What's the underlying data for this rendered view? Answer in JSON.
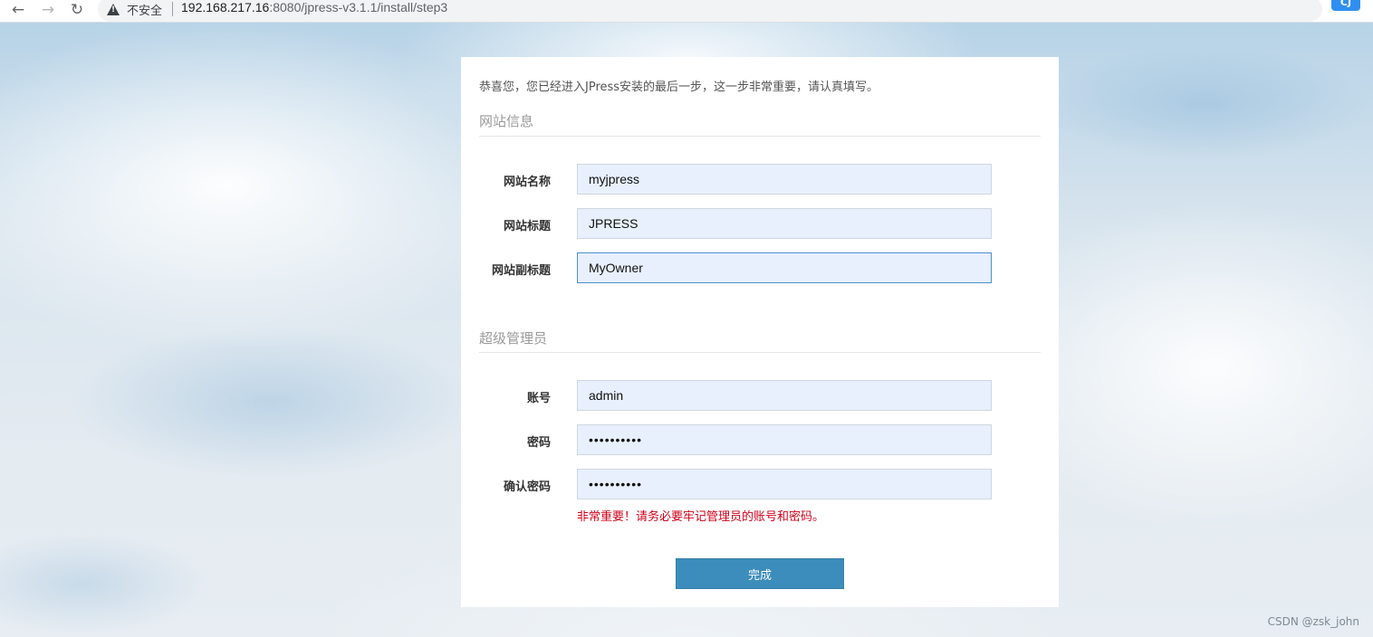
{
  "browser": {
    "insecure_label": "不安全",
    "url_host": "192.168.217.16",
    "url_rest": ":8080/jpress-v3.1.1/install/step3",
    "extension_label": "CJ"
  },
  "install": {
    "intro": "恭喜您，您已经进入JPress安装的最后一步，这一步非常重要，请认真填写。",
    "site_section_title": "网站信息",
    "site_name_label": "网站名称",
    "site_name_value": "myjpress",
    "site_title_label": "网站标题",
    "site_title_value": "JPRESS",
    "site_subtitle_label": "网站副标题",
    "site_subtitle_value": "MyOwner",
    "admin_section_title": "超级管理员",
    "account_label": "账号",
    "account_value": "admin",
    "password_label": "密码",
    "password_value": "••••••••••",
    "confirm_password_label": "确认密码",
    "confirm_password_value": "••••••••••",
    "warning_hint": "非常重要！请务必要牢记管理员的账号和密码。",
    "submit_label": "完成"
  },
  "watermark": "CSDN @zsk_john"
}
